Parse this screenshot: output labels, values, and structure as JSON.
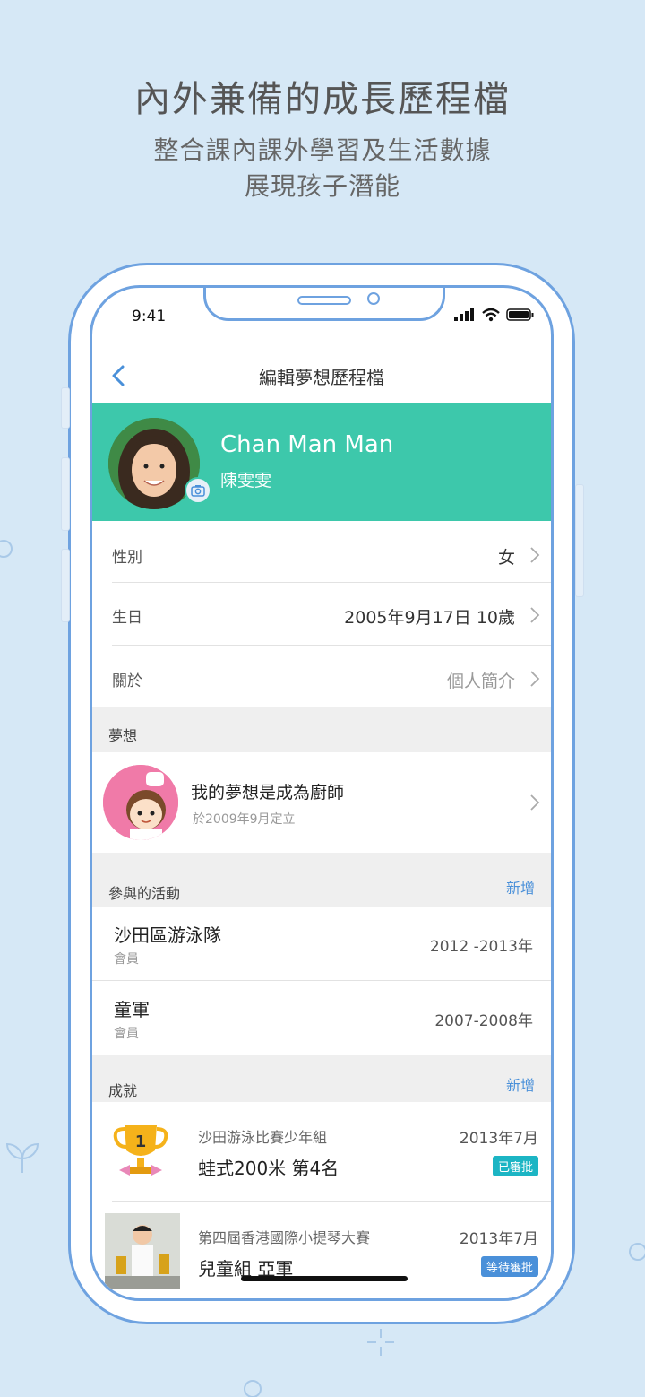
{
  "promo": {
    "headline": "內外兼備的成長歷程檔",
    "sub1": "整合課內課外學習及生活數據",
    "sub2": "展現孩子潛能"
  },
  "status": {
    "time": "9:41"
  },
  "nav": {
    "title": "編輯夢想歷程檔"
  },
  "profile": {
    "name": "Chan Man Man",
    "chinese_name": "陳雯雯"
  },
  "fields": [
    {
      "label": "性別",
      "value": "女"
    },
    {
      "label": "生日",
      "value": "2005年9月17日  10歲"
    },
    {
      "label": "關於",
      "value": "個人簡介"
    }
  ],
  "dream_section": {
    "header": "夢想",
    "title": "我的夢想是成為廚師",
    "subtitle": "於2009年9月定立"
  },
  "activities_section": {
    "header": "參與的活動",
    "add_label": "新增",
    "items": [
      {
        "name": "沙田區游泳隊",
        "role": "會員",
        "years": "2012 -2013年"
      },
      {
        "name": "童軍",
        "role": "會員",
        "years": "2007-2008年"
      }
    ]
  },
  "achievements_section": {
    "header": "成就",
    "add_label": "新增",
    "items": [
      {
        "org": "沙田游泳比賽少年組",
        "result": "蛙式200米 第4名",
        "date": "2013年7月",
        "status": "已審批",
        "status_color": "#1cb5c4"
      },
      {
        "org": "第四屆香港國際小提琴大賽",
        "result": "兒童組 亞軍",
        "date": "2013年7月",
        "status": "等待審批",
        "status_color": "#4a90d9"
      }
    ]
  },
  "colors": {
    "accent": "#3dc8ab",
    "link": "#4a90d9",
    "frame": "#6ea2e0",
    "background": "#d6e8f6"
  }
}
